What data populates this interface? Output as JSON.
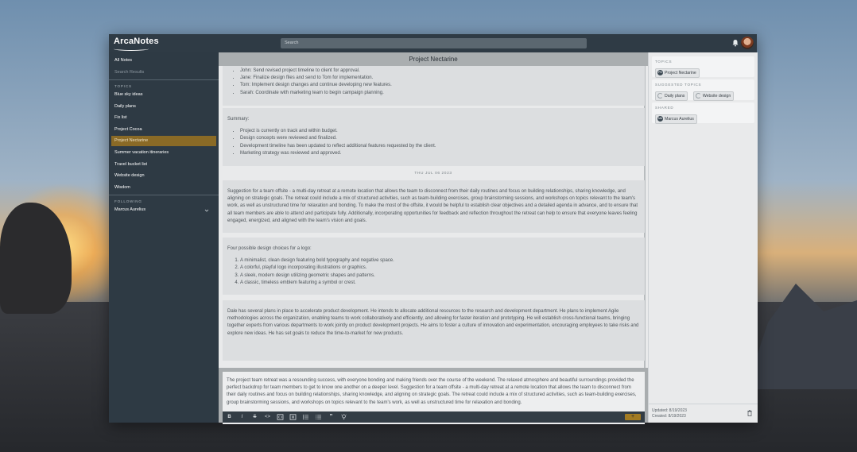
{
  "app": {
    "logo": "ArcaNotes",
    "search_placeholder": "Search"
  },
  "sidebar": {
    "all_notes": "All Notes",
    "search_results": "Search Results",
    "topics_heading": "TOPICS",
    "topics": [
      {
        "label": "Blue sky ideas"
      },
      {
        "label": "Daily plans"
      },
      {
        "label": "Fix list"
      },
      {
        "label": "Project Cocoa"
      },
      {
        "label": "Project Nectarine",
        "active": true
      },
      {
        "label": "Summer vacation itineraries"
      },
      {
        "label": "Travel bucket list"
      },
      {
        "label": "Website design"
      },
      {
        "label": "Wisdom"
      }
    ],
    "following_heading": "FOLLOWING",
    "following": [
      {
        "label": "Marcus Aurelius"
      }
    ]
  },
  "main": {
    "title": "Project Nectarine",
    "note1_items": [
      "John: Send revised project timeline to client for approval.",
      "Jane: Finalize design files and send to Tom for implementation.",
      "Tom: Implement design changes and continue developing new features.",
      "Sarah: Coordinate with marketing team to begin campaign planning."
    ],
    "note2_label": "Summary:",
    "note2_items": [
      "Project is currently on track and within budget.",
      "Design concepts were reviewed and finalized.",
      "Development timeline has been updated to reflect additional features requested by the client.",
      "Marketing strategy was reviewed and approved."
    ],
    "date_separator": "THU JUL 06 2023",
    "note3_text": "Suggestion for a team offsite - a multi-day retreat at a remote location that allows the team to disconnect from their daily routines and focus on building relationships, sharing knowledge, and aligning on strategic goals. The retreat could include a mix of structured activities, such as team-building exercises, group brainstorming sessions, and workshops on topics relevant to the team's work, as well as unstructured time for relaxation and bonding. To make the most of the offsite, it would be helpful to establish clear objectives and a detailed agenda in advance, and to ensure that all team members are able to attend and participate fully. Additionally, incorporating opportunities for feedback and reflection throughout the retreat can help to ensure that everyone leaves feeling engaged, energized, and aligned with the team's vision and goals.",
    "note4_label": "Four possible design choices for a logo:",
    "note4_items": [
      "A minimalist, clean design featuring bold typography and negative space.",
      "A colorful, playful logo incorporating illustrations or graphics.",
      "A sleek, modern design utilizing geometric shapes and patterns.",
      "A classic, timeless emblem featuring a symbol or crest."
    ],
    "note5_text": "Dale has several plans in place to accelerate product development. He intends to allocate additional resources to the research and development department. He plans to implement Agile methodologies across the organization, enabling teams to work collaboratively and efficiently, and allowing for faster iteration and prototyping. He will establish cross-functional teams, bringing together experts from various departments to work jointly on product development projects. He aims to foster a culture of innovation and experimentation, encouraging employees to take risks and explore new ideas. He has set goals to reduce the time-to-market for new products.",
    "editor_text": "The project team retreat was a resounding success, with everyone bonding and making friends over the course of the weekend. The relaxed atmosphere and beautiful surroundings provided the perfect backdrop for team members to get to know one another on a deeper level. Suggestion for a team offsite - a multi-day retreat at a remote location that allows the team to disconnect from their daily routines and focus on building relationships, sharing knowledge, and aligning on strategic goals. The retreat could include a mix of structured activities, such as team-building exercises, group brainstorming sessions, and workshops on topics relevant to the team's work, as well as unstructured time for relaxation and bonding.",
    "toolbar": {
      "bold": "B",
      "italic": "I",
      "strike": "S",
      "code": "<>",
      "bullet": "•",
      "quote": "”",
      "add": "+"
    }
  },
  "right": {
    "topics_heading": "TOPICS",
    "topics_chip": "Project Nectarine",
    "topics_chip_icon": "PN",
    "suggested_heading": "SUGGESTED TOPICS",
    "suggested": [
      "Daily plans",
      "Website design"
    ],
    "shared_heading": "SHARED",
    "shared_chip": "Marcus Aurelius",
    "shared_chip_icon": "MA",
    "updated": "Updated: 8/19/2023",
    "created": "Created: 8/19/2023"
  },
  "colors": {
    "topbar": "#2f3b45",
    "sidebar": "#2e3a44",
    "active_topic": "#8a6a26",
    "add_button": "#a27b22"
  }
}
